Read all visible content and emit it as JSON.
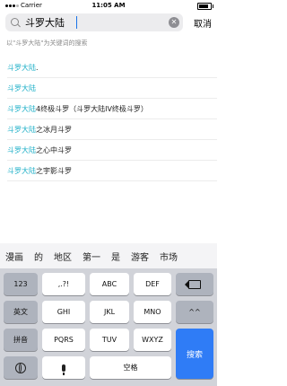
{
  "status": {
    "carrier": "Carrier",
    "time": "11:05 AM"
  },
  "search": {
    "value": "斗罗大陆",
    "cancel": "取消"
  },
  "hint": "以\"斗罗大陆\"为关键词的搜索",
  "results": [
    {
      "hl": "斗罗大陆",
      "rest": "."
    },
    {
      "hl": "斗罗大陆",
      "rest": ""
    },
    {
      "hl": "斗罗大陆",
      "rest": "4终极斗罗（斗罗大陆IV终极斗罗）"
    },
    {
      "hl": "斗罗大陆",
      "rest": "之冰月斗罗"
    },
    {
      "hl": "斗罗大陆",
      "rest": "之心中斗罗"
    },
    {
      "hl": "斗罗大陆",
      "rest": "之宇影斗罗"
    }
  ],
  "keyboard": {
    "suggestions": [
      "漫画",
      "的",
      "地区",
      "第一",
      "是",
      "游客",
      "市场"
    ],
    "row1": [
      "123",
      ",.?!",
      "ABC",
      "DEF"
    ],
    "row2": [
      "英文",
      "GHI",
      "JKL",
      "MNO",
      "^^"
    ],
    "row3": [
      "拼音",
      "PQRS",
      "TUV",
      "WXYZ"
    ],
    "space": "空格",
    "search": "搜索",
    "icons": {
      "delete": "delete-icon",
      "globe": "globe-icon",
      "mic": "microphone-icon"
    }
  }
}
